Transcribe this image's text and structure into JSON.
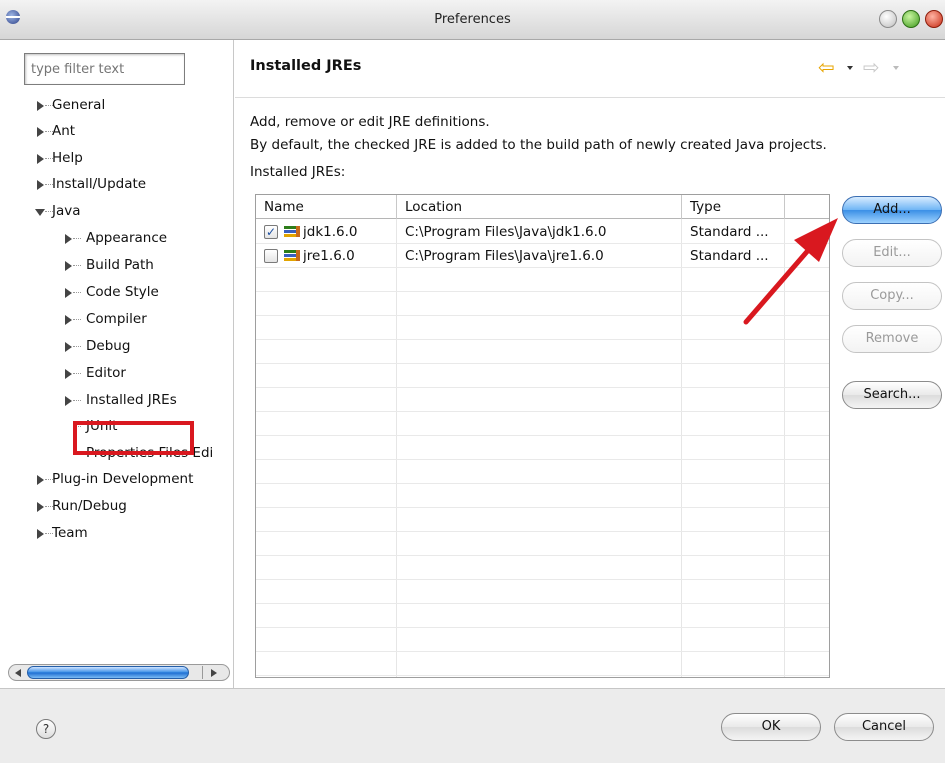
{
  "window": {
    "title": "Preferences"
  },
  "sidebar": {
    "filter_placeholder": "type filter text",
    "tree": [
      {
        "label": "General"
      },
      {
        "label": "Ant"
      },
      {
        "label": "Help"
      },
      {
        "label": "Install/Update"
      },
      {
        "label": "Java"
      },
      {
        "label": "Appearance"
      },
      {
        "label": "Build Path"
      },
      {
        "label": "Code Style"
      },
      {
        "label": "Compiler"
      },
      {
        "label": "Debug"
      },
      {
        "label": "Editor"
      },
      {
        "label": "Installed JREs"
      },
      {
        "label": "JUnit"
      },
      {
        "label": "Properties Files Edi"
      },
      {
        "label": "Plug-in Development"
      },
      {
        "label": "Run/Debug"
      },
      {
        "label": "Team"
      }
    ]
  },
  "main": {
    "title": "Installed JREs",
    "description_1": "Add, remove or edit JRE definitions.",
    "description_2": "By default, the checked JRE is added to the build path of newly created Java projects.",
    "table_label": "Installed JREs:",
    "columns": [
      "Name",
      "Location",
      "Type"
    ],
    "rows": [
      {
        "checked": true,
        "name": "jdk1.6.0",
        "location": "C:\\Program Files\\Java\\jdk1.6.0",
        "type": "Standard ..."
      },
      {
        "checked": false,
        "name": "jre1.6.0",
        "location": "C:\\Program Files\\Java\\jre1.6.0",
        "type": "Standard ..."
      }
    ],
    "buttons": {
      "add": "Add...",
      "edit": "Edit...",
      "copy": "Copy...",
      "remove": "Remove",
      "search": "Search..."
    }
  },
  "footer": {
    "help": "?",
    "ok": "OK",
    "cancel": "Cancel"
  },
  "colors": {
    "highlight_red": "#d9181f",
    "default_button_blue": "#3b8fe6"
  }
}
